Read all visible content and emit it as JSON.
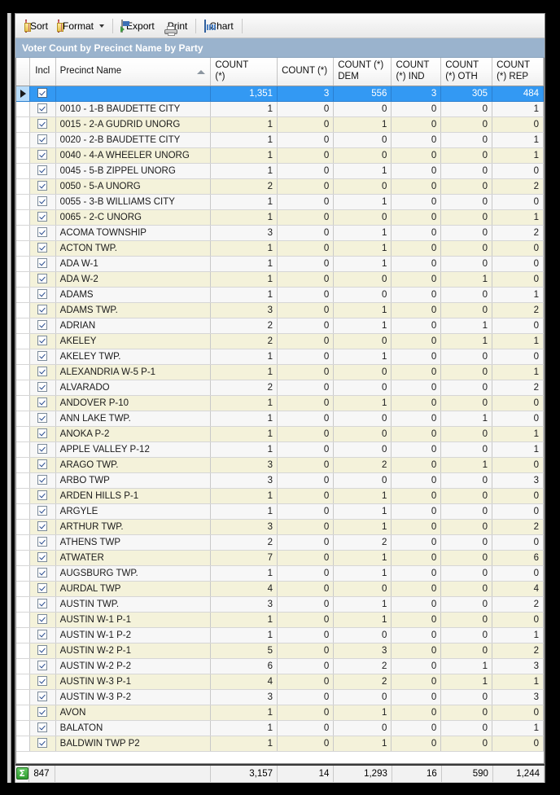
{
  "window": {
    "caption": "Voter Count by Precinct Name by Party"
  },
  "toolbar": {
    "sort_label": "Sort",
    "format_label": "Format",
    "export_label": "Export",
    "print_label": "Print",
    "chart_label": "Chart",
    "icons": {
      "sort": "grid-sort-icon",
      "format": "grid-format-icon",
      "export": "export-icon",
      "print": "printer-icon",
      "chart": "chart-icon",
      "format_caret": "chevron-down-icon"
    }
  },
  "grid": {
    "columns": [
      {
        "key": "indicator",
        "label": ""
      },
      {
        "key": "incl",
        "label": "Incl"
      },
      {
        "key": "name",
        "label": "Precinct Name",
        "sorted": "asc"
      },
      {
        "key": "count_star_total",
        "label": "COUNT (*)"
      },
      {
        "key": "count_star",
        "label": "COUNT (*)"
      },
      {
        "key": "count_dem",
        "label": "COUNT (*) DEM"
      },
      {
        "key": "count_ind",
        "label": "COUNT (*) IND"
      },
      {
        "key": "count_oth",
        "label": "COUNT (*) OTH"
      },
      {
        "key": "count_rep",
        "label": "COUNT (*) REP"
      }
    ],
    "header_lines": {
      "count_total_l1": "COUNT",
      "count_total_l2": "(*)",
      "count_star": "COUNT (*)",
      "dem_l1": "COUNT (*)",
      "dem_l2": "DEM",
      "ind_l1": "COUNT",
      "ind_l2": "(*) IND",
      "oth_l1": "COUNT",
      "oth_l2": "(*) OTH",
      "rep_l1": "COUNT",
      "rep_l2": "(*) REP"
    },
    "rows": [
      {
        "selected": true,
        "checked": true,
        "name": "",
        "total": "1,351",
        "star": "3",
        "dem": "556",
        "ind": "3",
        "oth": "305",
        "rep": "484"
      },
      {
        "checked": true,
        "name": "0010 - 1-B BAUDETTE CITY",
        "total": "1",
        "star": "0",
        "dem": "0",
        "ind": "0",
        "oth": "0",
        "rep": "1"
      },
      {
        "checked": true,
        "name": "0015 - 2-A GUDRID UNORG",
        "total": "1",
        "star": "0",
        "dem": "1",
        "ind": "0",
        "oth": "0",
        "rep": "0"
      },
      {
        "checked": true,
        "name": "0020 - 2-B BAUDETTE CITY",
        "total": "1",
        "star": "0",
        "dem": "0",
        "ind": "0",
        "oth": "0",
        "rep": "1"
      },
      {
        "checked": true,
        "name": "0040 - 4-A WHEELER UNORG",
        "total": "1",
        "star": "0",
        "dem": "0",
        "ind": "0",
        "oth": "0",
        "rep": "1"
      },
      {
        "checked": true,
        "name": "0045 - 5-B ZIPPEL UNORG",
        "total": "1",
        "star": "0",
        "dem": "1",
        "ind": "0",
        "oth": "0",
        "rep": "0"
      },
      {
        "checked": true,
        "name": "0050 - 5-A UNORG",
        "total": "2",
        "star": "0",
        "dem": "0",
        "ind": "0",
        "oth": "0",
        "rep": "2"
      },
      {
        "checked": true,
        "name": "0055 - 3-B WILLIAMS CITY",
        "total": "1",
        "star": "0",
        "dem": "1",
        "ind": "0",
        "oth": "0",
        "rep": "0"
      },
      {
        "checked": true,
        "name": "0065 - 2-C UNORG",
        "total": "1",
        "star": "0",
        "dem": "0",
        "ind": "0",
        "oth": "0",
        "rep": "1"
      },
      {
        "checked": true,
        "name": "ACOMA TOWNSHIP",
        "total": "3",
        "star": "0",
        "dem": "1",
        "ind": "0",
        "oth": "0",
        "rep": "2"
      },
      {
        "checked": true,
        "name": "ACTON TWP.",
        "total": "1",
        "star": "0",
        "dem": "1",
        "ind": "0",
        "oth": "0",
        "rep": "0"
      },
      {
        "checked": true,
        "name": "ADA W-1",
        "total": "1",
        "star": "0",
        "dem": "1",
        "ind": "0",
        "oth": "0",
        "rep": "0"
      },
      {
        "checked": true,
        "name": "ADA W-2",
        "total": "1",
        "star": "0",
        "dem": "0",
        "ind": "0",
        "oth": "1",
        "rep": "0"
      },
      {
        "checked": true,
        "name": "ADAMS",
        "total": "1",
        "star": "0",
        "dem": "0",
        "ind": "0",
        "oth": "0",
        "rep": "1"
      },
      {
        "checked": true,
        "name": "ADAMS TWP.",
        "total": "3",
        "star": "0",
        "dem": "1",
        "ind": "0",
        "oth": "0",
        "rep": "2"
      },
      {
        "checked": true,
        "name": "ADRIAN",
        "total": "2",
        "star": "0",
        "dem": "1",
        "ind": "0",
        "oth": "1",
        "rep": "0"
      },
      {
        "checked": true,
        "name": "AKELEY",
        "total": "2",
        "star": "0",
        "dem": "0",
        "ind": "0",
        "oth": "1",
        "rep": "1"
      },
      {
        "checked": true,
        "name": "AKELEY TWP.",
        "total": "1",
        "star": "0",
        "dem": "1",
        "ind": "0",
        "oth": "0",
        "rep": "0"
      },
      {
        "checked": true,
        "name": "ALEXANDRIA W-5 P-1",
        "total": "1",
        "star": "0",
        "dem": "0",
        "ind": "0",
        "oth": "0",
        "rep": "1"
      },
      {
        "checked": true,
        "name": "ALVARADO",
        "total": "2",
        "star": "0",
        "dem": "0",
        "ind": "0",
        "oth": "0",
        "rep": "2"
      },
      {
        "checked": true,
        "name": "ANDOVER P-10",
        "total": "1",
        "star": "0",
        "dem": "1",
        "ind": "0",
        "oth": "0",
        "rep": "0"
      },
      {
        "checked": true,
        "name": "ANN LAKE TWP.",
        "total": "1",
        "star": "0",
        "dem": "0",
        "ind": "0",
        "oth": "1",
        "rep": "0"
      },
      {
        "checked": true,
        "name": "ANOKA P-2",
        "total": "1",
        "star": "0",
        "dem": "0",
        "ind": "0",
        "oth": "0",
        "rep": "1"
      },
      {
        "checked": true,
        "name": "APPLE VALLEY P-12",
        "total": "1",
        "star": "0",
        "dem": "0",
        "ind": "0",
        "oth": "0",
        "rep": "1"
      },
      {
        "checked": true,
        "name": "ARAGO TWP.",
        "total": "3",
        "star": "0",
        "dem": "2",
        "ind": "0",
        "oth": "1",
        "rep": "0"
      },
      {
        "checked": true,
        "name": "ARBO TWP",
        "total": "3",
        "star": "0",
        "dem": "0",
        "ind": "0",
        "oth": "0",
        "rep": "3"
      },
      {
        "checked": true,
        "name": "ARDEN HILLS P-1",
        "total": "1",
        "star": "0",
        "dem": "1",
        "ind": "0",
        "oth": "0",
        "rep": "0"
      },
      {
        "checked": true,
        "name": "ARGYLE",
        "total": "1",
        "star": "0",
        "dem": "1",
        "ind": "0",
        "oth": "0",
        "rep": "0"
      },
      {
        "checked": true,
        "name": "ARTHUR TWP.",
        "total": "3",
        "star": "0",
        "dem": "1",
        "ind": "0",
        "oth": "0",
        "rep": "2"
      },
      {
        "checked": true,
        "name": "ATHENS TWP",
        "total": "2",
        "star": "0",
        "dem": "2",
        "ind": "0",
        "oth": "0",
        "rep": "0"
      },
      {
        "checked": true,
        "name": "ATWATER",
        "total": "7",
        "star": "0",
        "dem": "1",
        "ind": "0",
        "oth": "0",
        "rep": "6"
      },
      {
        "checked": true,
        "name": "AUGSBURG TWP.",
        "total": "1",
        "star": "0",
        "dem": "1",
        "ind": "0",
        "oth": "0",
        "rep": "0"
      },
      {
        "checked": true,
        "name": "AURDAL TWP",
        "total": "4",
        "star": "0",
        "dem": "0",
        "ind": "0",
        "oth": "0",
        "rep": "4"
      },
      {
        "checked": true,
        "name": "AUSTIN TWP.",
        "total": "3",
        "star": "0",
        "dem": "1",
        "ind": "0",
        "oth": "0",
        "rep": "2"
      },
      {
        "checked": true,
        "name": "AUSTIN W-1 P-1",
        "total": "1",
        "star": "0",
        "dem": "1",
        "ind": "0",
        "oth": "0",
        "rep": "0"
      },
      {
        "checked": true,
        "name": "AUSTIN W-1 P-2",
        "total": "1",
        "star": "0",
        "dem": "0",
        "ind": "0",
        "oth": "0",
        "rep": "1"
      },
      {
        "checked": true,
        "name": "AUSTIN W-2 P-1",
        "total": "5",
        "star": "0",
        "dem": "3",
        "ind": "0",
        "oth": "0",
        "rep": "2"
      },
      {
        "checked": true,
        "name": "AUSTIN W-2 P-2",
        "total": "6",
        "star": "0",
        "dem": "2",
        "ind": "0",
        "oth": "1",
        "rep": "3"
      },
      {
        "checked": true,
        "name": "AUSTIN W-3 P-1",
        "total": "4",
        "star": "0",
        "dem": "2",
        "ind": "0",
        "oth": "1",
        "rep": "1"
      },
      {
        "checked": true,
        "name": "AUSTIN W-3 P-2",
        "total": "3",
        "star": "0",
        "dem": "0",
        "ind": "0",
        "oth": "0",
        "rep": "3"
      },
      {
        "checked": true,
        "name": "AVON",
        "total": "1",
        "star": "0",
        "dem": "1",
        "ind": "0",
        "oth": "0",
        "rep": "0"
      },
      {
        "checked": true,
        "name": "BALATON",
        "total": "1",
        "star": "0",
        "dem": "0",
        "ind": "0",
        "oth": "0",
        "rep": "1"
      },
      {
        "checked": true,
        "name": "BALDWIN TWP P2",
        "total": "1",
        "star": "0",
        "dem": "1",
        "ind": "0",
        "oth": "0",
        "rep": "0"
      }
    ]
  },
  "footer": {
    "sigma_icon": "sum-sigma-icon",
    "row_count": "847",
    "name": "",
    "total": "3,157",
    "star": "14",
    "dem": "1,293",
    "ind": "16",
    "oth": "590",
    "rep": "1,244"
  },
  "colors": {
    "selection": "#3399f3",
    "caption_bar": "#9ab3cd",
    "alt_row": "#f4f2da",
    "norm_row": "#f7f7f7"
  }
}
